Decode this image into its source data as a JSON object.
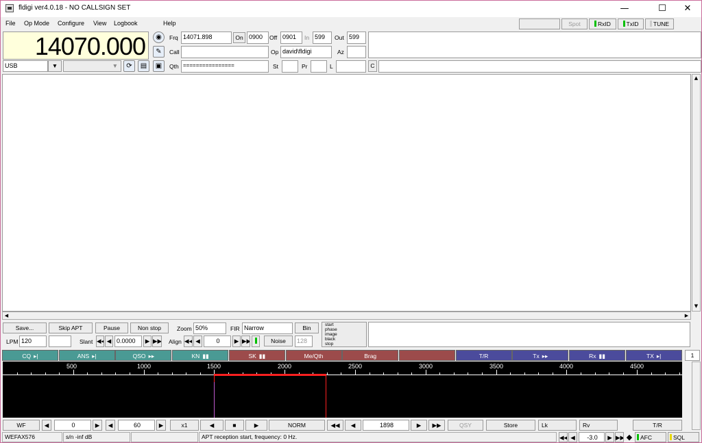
{
  "window": {
    "title": "fldigi ver4.0.18 - NO CALLSIGN SET",
    "minimize": "—",
    "maximize": "☐",
    "close": "✕"
  },
  "menu": {
    "file": "File",
    "opmode": "Op Mode",
    "configure": "Configure",
    "view": "View",
    "logbook": "Logbook",
    "help": "Help"
  },
  "topright": {
    "spot": "Spot",
    "rxid": "RxID",
    "txid": "TxID",
    "tune": "TUNE"
  },
  "freq": {
    "display": "14070.000"
  },
  "mode": {
    "value": "USB"
  },
  "log": {
    "frq_label": "Frq",
    "frq": "14071.898",
    "on_label": "On",
    "on": "0900",
    "off_label": "Off",
    "off": "0901",
    "in_label": "In",
    "in": "599",
    "out_label": "Out",
    "out": "599",
    "call_label": "Call",
    "call": "",
    "op_label": "Op",
    "op": "david\\fldigi",
    "az_label": "Az",
    "az": "",
    "qth_label": "Qth",
    "qth": "================",
    "st_label": "St",
    "pr_label": "Pr",
    "l_label": "L",
    "c_label": "C"
  },
  "wefax": {
    "save": "Save...",
    "skip": "Skip APT",
    "pause": "Pause",
    "nonstop": "Non stop",
    "zoom_label": "Zoom",
    "zoom": "50%",
    "fir_label": "FIR",
    "fir": "Narrow",
    "bin": "Bin",
    "states": [
      "start",
      "phase",
      "image",
      "black",
      "stop"
    ],
    "lpm_label": "LPM",
    "lpm": "120",
    "slant_label": "Slant",
    "slant": "0.0000",
    "align_label": "Align",
    "align": "0",
    "noise": "Noise",
    "noise_val": "128"
  },
  "macros": [
    {
      "label": "CQ",
      "color": "#4a9a94",
      "arrow": "▸|"
    },
    {
      "label": "ANS",
      "color": "#4a9a94",
      "arrow": "▸|"
    },
    {
      "label": "QSO",
      "color": "#4a9a94",
      "arrow": "▸▸"
    },
    {
      "label": "KN",
      "color": "#4a9a94",
      "arrow": "▮▮"
    },
    {
      "label": "SK",
      "color": "#9c4b4b",
      "arrow": "▮▮"
    },
    {
      "label": "Me/Qth",
      "color": "#9c4b4b",
      "arrow": ""
    },
    {
      "label": "Brag",
      "color": "#9c4b4b",
      "arrow": ""
    },
    {
      "label": "",
      "color": "#9c4b4b",
      "arrow": ""
    },
    {
      "label": "T/R",
      "color": "#4b4b9c",
      "arrow": ""
    },
    {
      "label": "Tx",
      "color": "#4b4b9c",
      "arrow": "▸▸"
    },
    {
      "label": "Rx",
      "color": "#4b4b9c",
      "arrow": "▮▮"
    },
    {
      "label": "TX",
      "color": "#4b4b9c",
      "arrow": "▸|"
    }
  ],
  "macro_page": "1",
  "scale": [
    "500",
    "1000",
    "1500",
    "2000",
    "2500",
    "3000",
    "3500",
    "4000",
    "4500"
  ],
  "wfbar": {
    "wf": "WF",
    "offset": "0",
    "speed": "60",
    "x1": "x1",
    "norm": "NORM",
    "freq": "1898",
    "qsy": "QSY",
    "store": "Store",
    "lk": "Lk",
    "rv": "Rv",
    "tr": "T/R"
  },
  "status": {
    "mode": "WEFAX576",
    "sn": "s/n -inf dB",
    "msg": "APT reception start, frequency: 0 Hz.",
    "sql_val": "-3.0",
    "afc": "AFC",
    "sql": "SQL"
  },
  "colors": {
    "green": "#00c000",
    "yellow": "#e8d800",
    "cursor": "#ff2020",
    "freqbg": "#ffffdc"
  }
}
